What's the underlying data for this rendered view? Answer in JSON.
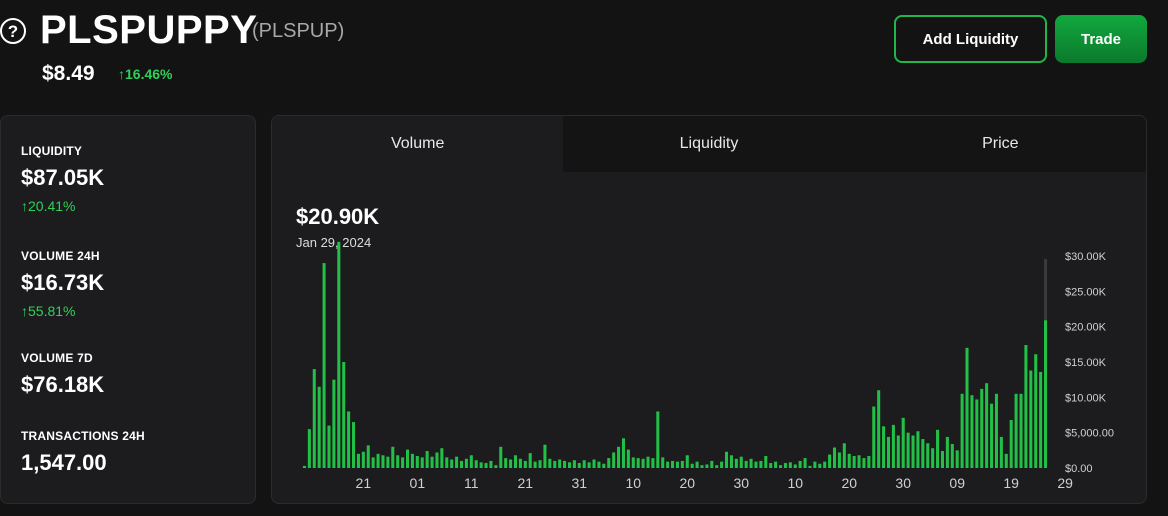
{
  "header": {
    "help_glyph": "?",
    "token_name": "PLSPUPPY",
    "token_symbol": "(PLSPUP)",
    "price": "$8.49",
    "price_change": "↑16.46%",
    "buttons": {
      "add_liquidity": "Add Liquidity",
      "trade": "Trade"
    }
  },
  "stats": {
    "liquidity": {
      "label": "LIQUIDITY",
      "value": "$87.05K",
      "change": "↑20.41%"
    },
    "volume_24h": {
      "label": "VOLUME 24H",
      "value": "$16.73K",
      "change": "↑55.81%"
    },
    "volume_7d": {
      "label": "VOLUME 7D",
      "value": "$76.18K"
    },
    "transactions_24h": {
      "label": "TRANSACTIONS 24H",
      "value": "1,547.00"
    }
  },
  "chart_panel": {
    "tabs": [
      {
        "label": "Volume",
        "active": true
      },
      {
        "label": "Liquidity",
        "active": false
      },
      {
        "label": "Price",
        "active": false
      }
    ],
    "selected_value": "$20.90K",
    "selected_date": "Jan 29, 2024"
  },
  "colors": {
    "accent": "#20b64a",
    "positive": "#2fd05a",
    "bar": "#22c046",
    "panel": "#1c1c1e",
    "background": "#131313"
  },
  "chart_data": {
    "type": "bar",
    "x_tick_labels": [
      "21",
      "01",
      "11",
      "21",
      "31",
      "10",
      "20",
      "30",
      "10",
      "20",
      "30",
      "09",
      "19",
      "29"
    ],
    "x_tick_bar_index": [
      12,
      23,
      34,
      45,
      56,
      67,
      78,
      89,
      100,
      111,
      122,
      133,
      144,
      155
    ],
    "y_tick_labels": [
      "$0.00",
      "$5,000.00",
      "$10.00K",
      "$15.00K",
      "$20.00K",
      "$25.00K",
      "$30.00K"
    ],
    "y_tick_values": [
      0,
      5000,
      10000,
      15000,
      20000,
      25000,
      30000
    ],
    "ylim": [
      0,
      30000
    ],
    "values": [
      300,
      5500,
      14000,
      11500,
      29000,
      6000,
      12500,
      32000,
      15000,
      8000,
      6500,
      2000,
      2300,
      3200,
      1500,
      2000,
      1800,
      1600,
      3000,
      1800,
      1500,
      2600,
      2000,
      1700,
      1500,
      2400,
      1600,
      2200,
      2800,
      1500,
      1200,
      1600,
      1000,
      1300,
      1800,
      1100,
      800,
      700,
      1000,
      400,
      3000,
      1400,
      1200,
      1800,
      1300,
      1000,
      2100,
      900,
      1100,
      3300,
      1300,
      1000,
      1200,
      1000,
      800,
      1100,
      700,
      1100,
      800,
      1200,
      900,
      600,
      1400,
      2200,
      3000,
      4200,
      2600,
      1500,
      1400,
      1300,
      1600,
      1400,
      8000,
      1500,
      900,
      1000,
      900,
      1000,
      1800,
      600,
      900,
      400,
      500,
      1000,
      400,
      900,
      2300,
      1800,
      1300,
      1600,
      1000,
      1300,
      900,
      1000,
      1700,
      700,
      900,
      400,
      700,
      800,
      500,
      1000,
      1400,
      300,
      900,
      600,
      900,
      1900,
      2900,
      2200,
      3500,
      2000,
      1700,
      1800,
      1400,
      1700,
      8700,
      11000,
      5900,
      4400,
      6100,
      4600,
      7100,
      5000,
      4600,
      5200,
      4100,
      3500,
      2800,
      5400,
      2400,
      4400,
      3400,
      2500,
      10500,
      17000,
      10300,
      9700,
      11200,
      12000,
      9100,
      10500,
      4400,
      2000,
      6800,
      10500,
      10500,
      17400,
      13800,
      16100,
      13600,
      20900
    ]
  }
}
